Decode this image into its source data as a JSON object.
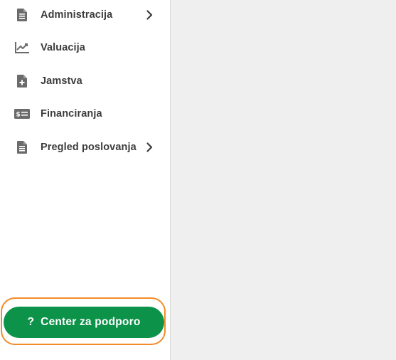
{
  "sidebar": {
    "items": [
      {
        "label": "Administracija",
        "icon": "document-icon",
        "has_submenu": true
      },
      {
        "label": "Valuacija",
        "icon": "chart-line-icon",
        "has_submenu": false
      },
      {
        "label": "Jamstva",
        "icon": "file-plus-icon",
        "has_submenu": false
      },
      {
        "label": "Financiranja",
        "icon": "money-bill-icon",
        "has_submenu": false
      },
      {
        "label": "Pregled poslovanja",
        "icon": "document-icon",
        "has_submenu": true
      }
    ]
  },
  "support": {
    "icon_glyph": "?",
    "label": "Center za podporo"
  },
  "colors": {
    "support_button": "#0c9349",
    "focus_ring": "#f28c28",
    "main_background": "#efefef",
    "icon": "#6b6b6b",
    "text": "#3c3c3c"
  }
}
